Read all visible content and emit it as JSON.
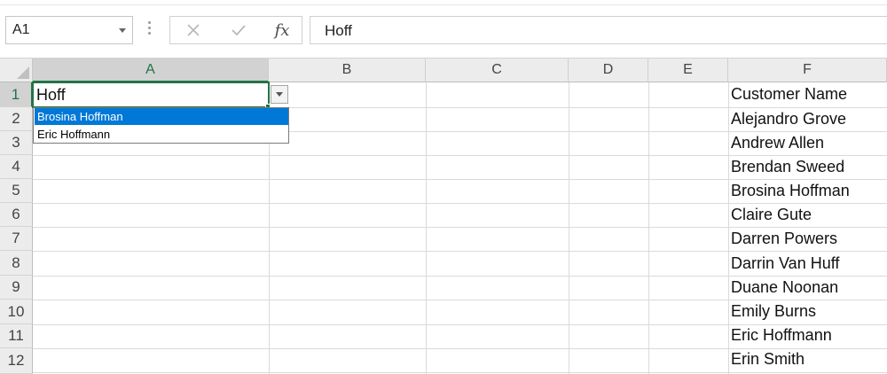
{
  "name_box": {
    "value": "A1"
  },
  "formula_bar": {
    "cancel_icon": "x-icon",
    "enter_icon": "check-icon",
    "function_label": "fx",
    "value": "Hoff"
  },
  "columns": [
    "A",
    "B",
    "C",
    "D",
    "E",
    "F"
  ],
  "rows": [
    "1",
    "2",
    "3",
    "4",
    "5",
    "6",
    "7",
    "8",
    "9",
    "10",
    "11",
    "12"
  ],
  "active_cell": {
    "ref": "A1",
    "value": "Hoff"
  },
  "dropdown": {
    "items": [
      "Brosina Hoffman",
      "Eric Hoffmann"
    ],
    "highlighted": "Brosina Hoffman"
  },
  "column_f": [
    "Customer Name",
    "Alejandro Grove",
    "Andrew Allen",
    "Brendan Sweed",
    "Brosina Hoffman",
    "Claire Gute",
    "Darren Powers",
    "Darrin Van Huff",
    "Duane Noonan",
    "Emily Burns",
    "Eric Hoffmann",
    "Erin Smith"
  ],
  "colors": {
    "accent": "#217346",
    "highlight": "#0078d7"
  }
}
